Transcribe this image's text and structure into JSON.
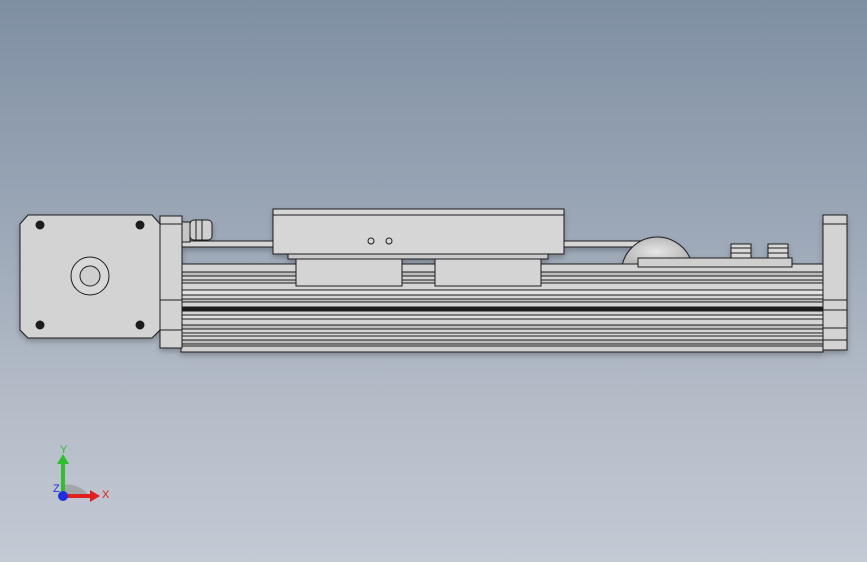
{
  "viewport": {
    "background_top": "#7f8fa3",
    "background_bottom": "#c4cad4"
  },
  "model": {
    "part_color": "#d3d3d3",
    "edge_color": "#1e1e1e",
    "dark_color": "#3a3a3a"
  },
  "triad": {
    "x_label": "X",
    "y_label": "Y",
    "z_label": "Z",
    "x_color": "#e0201f",
    "y_color": "#2fbf2f",
    "z_color": "#1f2fe0"
  }
}
